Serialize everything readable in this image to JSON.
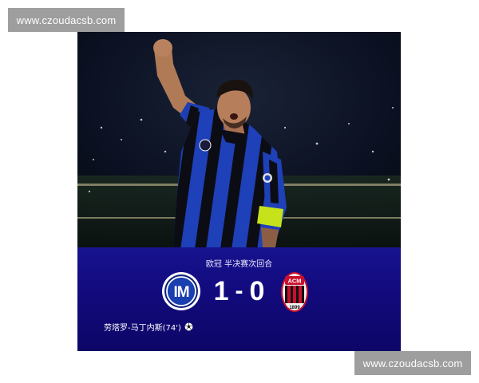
{
  "watermarks": {
    "top": "www.czoudacsb.com",
    "bottom": "www.czoudacsb.com"
  },
  "match": {
    "competition": "欧冠 半决赛次回合",
    "home_score": "1",
    "separator": "-",
    "away_score": "0",
    "scorer": "劳塔罗-马丁内斯(74')"
  },
  "icons": {
    "home_crest": "inter-milan-crest-icon",
    "away_crest": "ac-milan-crest-icon",
    "goal": "soccer-ball-icon"
  },
  "crest_lettering": {
    "home": "IM",
    "away_top": "ACM",
    "away_bottom": "1899"
  },
  "colors": {
    "scorebar": "#130c86",
    "inter_blue": "#1a3fb0",
    "milan_red": "#c8102e",
    "captain_band": "#c5e21b"
  }
}
